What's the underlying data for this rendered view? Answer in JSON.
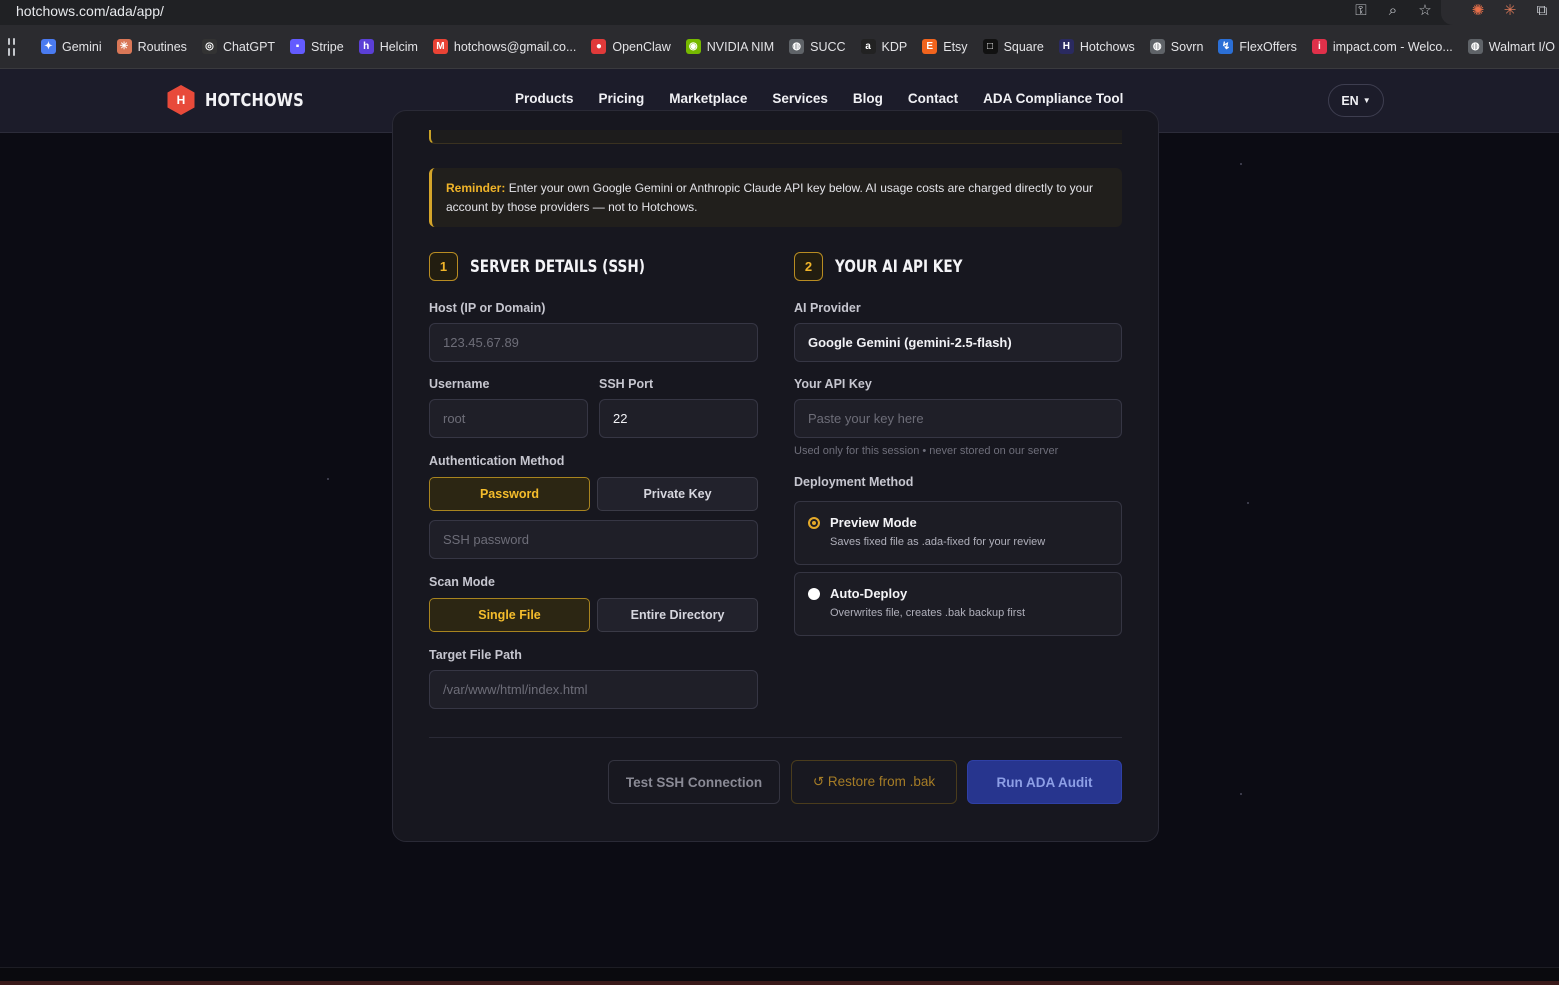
{
  "browser": {
    "url": "hotchows.com/ada/app/",
    "bookmarks": [
      {
        "label": "Gemini",
        "icon": "gemini-icon",
        "color": "#4a7bf0"
      },
      {
        "label": "Routines",
        "icon": "claude-icon",
        "color": "#d97757"
      },
      {
        "label": "ChatGPT",
        "icon": "chatgpt-icon",
        "color": "#333333"
      },
      {
        "label": "Stripe",
        "icon": "stripe-icon",
        "color": "#635bff"
      },
      {
        "label": "Helcim",
        "icon": "helcim-icon",
        "color": "#5b3fd6"
      },
      {
        "label": "hotchows@gmail.co...",
        "icon": "gmail-icon",
        "color": "#ea4335"
      },
      {
        "label": "OpenClaw",
        "icon": "openclaw-icon",
        "color": "#e03a3a"
      },
      {
        "label": "NVIDIA NIM",
        "icon": "nvidia-icon",
        "color": "#76b900"
      },
      {
        "label": "SUCC",
        "icon": "globe-icon",
        "color": "#5f6368"
      },
      {
        "label": "KDP",
        "icon": "amazon-icon",
        "color": "#222222"
      },
      {
        "label": "Etsy",
        "icon": "etsy-icon",
        "color": "#f1641e"
      },
      {
        "label": "Square",
        "icon": "square-icon",
        "color": "#111111"
      },
      {
        "label": "Hotchows",
        "icon": "hotchows-icon",
        "color": "#2a2a60"
      },
      {
        "label": "Sovrn",
        "icon": "globe-icon",
        "color": "#5f6368"
      },
      {
        "label": "FlexOffers",
        "icon": "flexoffers-icon",
        "color": "#2b6fd6"
      },
      {
        "label": "impact.com - Welco...",
        "icon": "impact-icon",
        "color": "#e0304a"
      },
      {
        "label": "Walmart I/O",
        "icon": "globe-icon",
        "color": "#5f6368"
      }
    ]
  },
  "header": {
    "logo_text": "HOTCHOWS",
    "logo_mark": "H",
    "nav": [
      "Products",
      "Pricing",
      "Marketplace",
      "Services",
      "Blog",
      "Contact",
      "ADA Compliance Tool"
    ],
    "language": "EN"
  },
  "reminder": {
    "label": "Reminder:",
    "text": "Enter your own Google Gemini or Anthropic Claude API key below. AI usage costs are charged directly to your account by those providers — not to Hotchows."
  },
  "server": {
    "step": "1",
    "title": "SERVER DETAILS (SSH)",
    "host_label": "Host (IP or Domain)",
    "host_placeholder": "123.45.67.89",
    "username_label": "Username",
    "username_placeholder": "root",
    "port_label": "SSH Port",
    "port_value": "22",
    "auth_label": "Authentication Method",
    "auth_options": [
      "Password",
      "Private Key"
    ],
    "auth_selected": "Password",
    "password_placeholder": "SSH password",
    "scan_label": "Scan Mode",
    "scan_options": [
      "Single File",
      "Entire Directory"
    ],
    "scan_selected": "Single File",
    "target_label": "Target File Path",
    "target_placeholder": "/var/www/html/index.html"
  },
  "ai": {
    "step": "2",
    "title": "YOUR AI API KEY",
    "provider_label": "AI Provider",
    "provider_value": "Google Gemini (gemini-2.5-flash)",
    "key_label": "Your API Key",
    "key_placeholder": "Paste your key here",
    "key_hint": "Used only for this session • never stored on our server",
    "deploy_label": "Deployment Method",
    "deploy_options": [
      {
        "title": "Preview Mode",
        "desc": "Saves fixed file as .ada-fixed for your review",
        "selected": true
      },
      {
        "title": "Auto-Deploy",
        "desc": "Overwrites file, creates .bak backup first",
        "selected": false
      }
    ]
  },
  "actions": {
    "test": "Test SSH Connection",
    "restore": "↺ Restore from .bak",
    "run": "Run ADA Audit"
  },
  "colors": {
    "accent": "#f0b429",
    "brand": "#e84a3a",
    "primary": "#27358e"
  }
}
